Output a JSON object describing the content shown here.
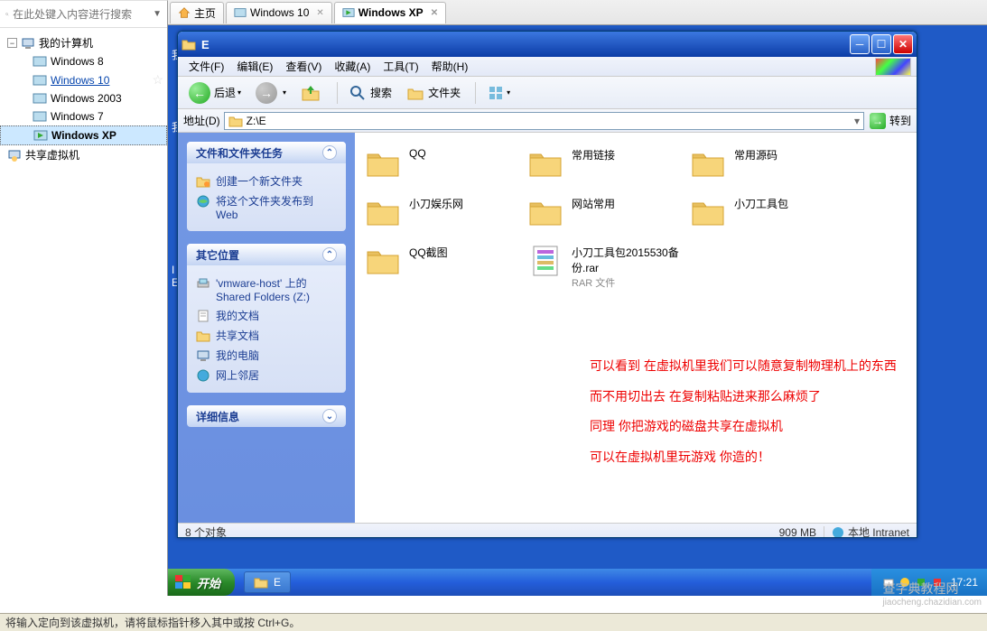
{
  "search": {
    "placeholder": "在此处键入内容进行搜索",
    "dropdown": "▼"
  },
  "tree": {
    "root": "我的计算机",
    "items": [
      "Windows 8",
      "Windows 10",
      "Windows 2003",
      "Windows 7",
      "Windows XP"
    ],
    "shared": "共享虚拟机"
  },
  "tabs": {
    "home": "主页",
    "items": [
      "Windows 10",
      "Windows XP"
    ]
  },
  "xp_window": {
    "title": "E",
    "menu": {
      "file": "文件(F)",
      "edit": "编辑(E)",
      "view": "查看(V)",
      "favorites": "收藏(A)",
      "tools": "工具(T)",
      "help": "帮助(H)"
    },
    "toolbar": {
      "back": "后退",
      "search": "搜索",
      "folders": "文件夹"
    },
    "address": {
      "label": "地址(D)",
      "value": "Z:\\E",
      "go": "转到"
    },
    "side": {
      "tasks_hd": "文件和文件夹任务",
      "tasks": [
        "创建一个新文件夹",
        "将这个文件夹发布到 Web"
      ],
      "other_hd": "其它位置",
      "other": [
        "'vmware-host' 上的 Shared Folders (Z:)",
        "我的文档",
        "共享文档",
        "我的电脑",
        "网上邻居"
      ],
      "detail_hd": "详细信息"
    },
    "folders": [
      {
        "name": "QQ"
      },
      {
        "name": "常用链接"
      },
      {
        "name": "常用源码"
      },
      {
        "name": "小刀娱乐网"
      },
      {
        "name": "网站常用"
      },
      {
        "name": "小刀工具包"
      },
      {
        "name": "QQ截图"
      }
    ],
    "rar_file": {
      "name": "小刀工具包2015530备份.rar",
      "type": "RAR 文件"
    },
    "status": {
      "objects": "8 个对象",
      "size": "909 MB",
      "zone": "本地 Intranet"
    },
    "annotations": [
      "可以看到 在虚拟机里我们可以随意复制物理机上的东西",
      "而不用切出去 在复制粘贴进来那么麻烦了",
      "同理 你把游戏的磁盘共享在虚拟机",
      "可以在虚拟机里玩游戏 你造的！"
    ]
  },
  "taskbar": {
    "start": "开始",
    "items": [
      "E"
    ],
    "time": "17:21"
  },
  "host_bar": "将输入定向到该虚拟机，请将鼠标指针移入其中或按 Ctrl+G。",
  "watermark": {
    "main": "查字典教程网",
    "sub": "jiaocheng.chazidian.com"
  }
}
